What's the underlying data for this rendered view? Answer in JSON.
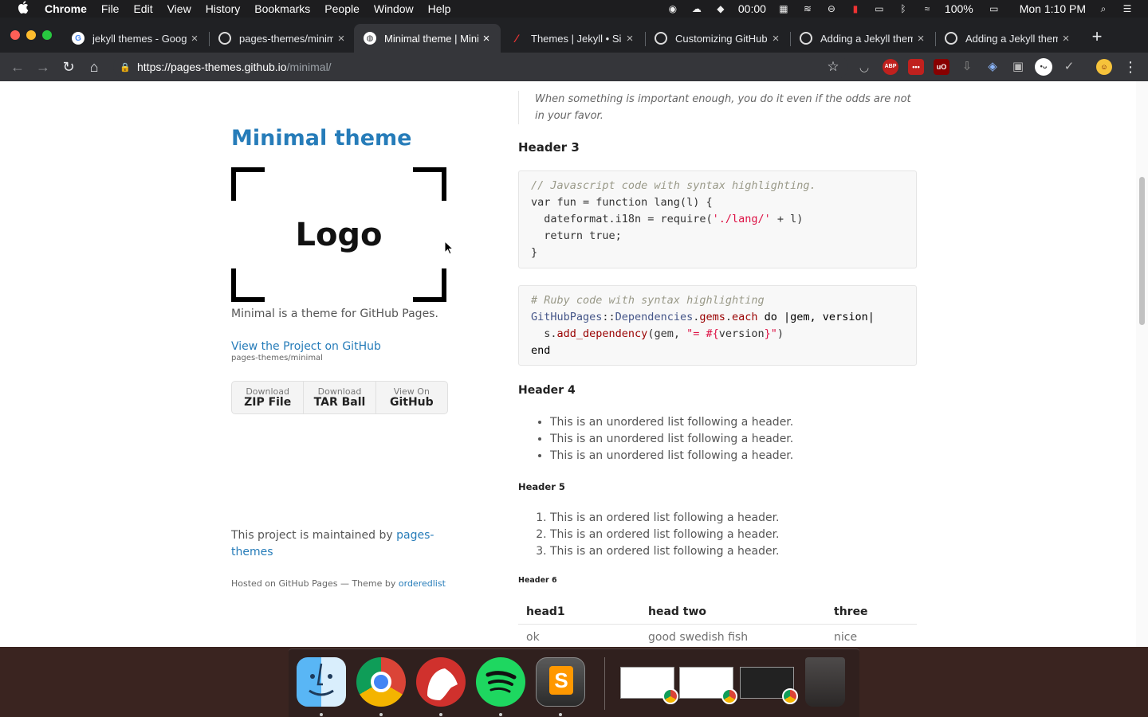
{
  "menubar": {
    "apple": "",
    "items": [
      "Chrome",
      "File",
      "Edit",
      "View",
      "History",
      "Bookmarks",
      "People",
      "Window",
      "Help"
    ],
    "timer": "00:00",
    "battery": "100%",
    "clock": "Mon 1:10 PM"
  },
  "tabs": [
    {
      "title": "jekyll themes - Goog",
      "icon": "google-icon"
    },
    {
      "title": "pages-themes/minim",
      "icon": "github-icon"
    },
    {
      "title": "Minimal theme | Mini",
      "icon": "globe-icon",
      "active": true
    },
    {
      "title": "Themes | Jekyll • Sir",
      "icon": "jekyll-icon"
    },
    {
      "title": "Customizing GitHub",
      "icon": "github-icon"
    },
    {
      "title": "Adding a Jekyll them",
      "icon": "github-icon"
    },
    {
      "title": "Adding a Jekyll them",
      "icon": "github-icon"
    }
  ],
  "omnibox": {
    "host": "https://pages-themes.github.io",
    "path": "/minimal/"
  },
  "extensions": {
    "abp": "ABP",
    "ublock": "uO"
  },
  "sidebar": {
    "site_title": "Minimal theme",
    "logo": "Logo",
    "description": "Minimal is a theme for GitHub Pages.",
    "project_link": "View the Project on GitHub",
    "project_sub": "pages-themes/minimal",
    "downloads": [
      {
        "small": "Download",
        "big": "ZIP File"
      },
      {
        "small": "Download",
        "big": "TAR Ball"
      },
      {
        "small": "View On",
        "big": "GitHub"
      }
    ],
    "maintained_prefix": "This project is maintained by ",
    "maintained_link": "pages-themes",
    "hosted_prefix": "Hosted on GitHub Pages — Theme by ",
    "hosted_link": "orderedlist"
  },
  "content": {
    "quote": "When something is important enough, you do it even if the odds are not in your favor.",
    "header3": "Header 3",
    "header4": "Header 4",
    "header5": "Header 5",
    "header6": "Header 6",
    "unordered": [
      "This is an unordered list following a header.",
      "This is an unordered list following a header.",
      "This is an unordered list following a header."
    ],
    "ordered": [
      "This is an ordered list following a header.",
      "This is an ordered list following a header.",
      "This is an ordered list following a header."
    ],
    "table": {
      "headers": [
        "head1",
        "head two",
        "three"
      ],
      "rows": [
        [
          "ok",
          "good swedish fish",
          "nice"
        ]
      ]
    }
  },
  "code_js": {
    "comment": "// Javascript code with syntax highlighting.",
    "l2": "var fun = function lang(l) {",
    "l3a": "  dateformat.i18n = require(",
    "l3str": "'./lang/'",
    "l3b": " + l)",
    "l4": "  return true;",
    "l5": "}"
  },
  "code_rb": {
    "comment": "# Ruby code with syntax highlighting",
    "cls1": "GitHubPages",
    "sep": "::",
    "cls2": "Dependencies",
    "dot1": ".",
    "m1": "gems",
    "dot2": ".",
    "m2": "each",
    "rest1": " do |gem, version|",
    "l3a": "  s.",
    "l3m": "add_dependency",
    "l3b": "(gem, ",
    "l3str": "\"= #{",
    "l3v": "version",
    "l3str2": "}\"",
    "l3c": ")",
    "l4": "end"
  },
  "colors": {
    "link": "#267CB9",
    "accent": "#267CB9"
  }
}
